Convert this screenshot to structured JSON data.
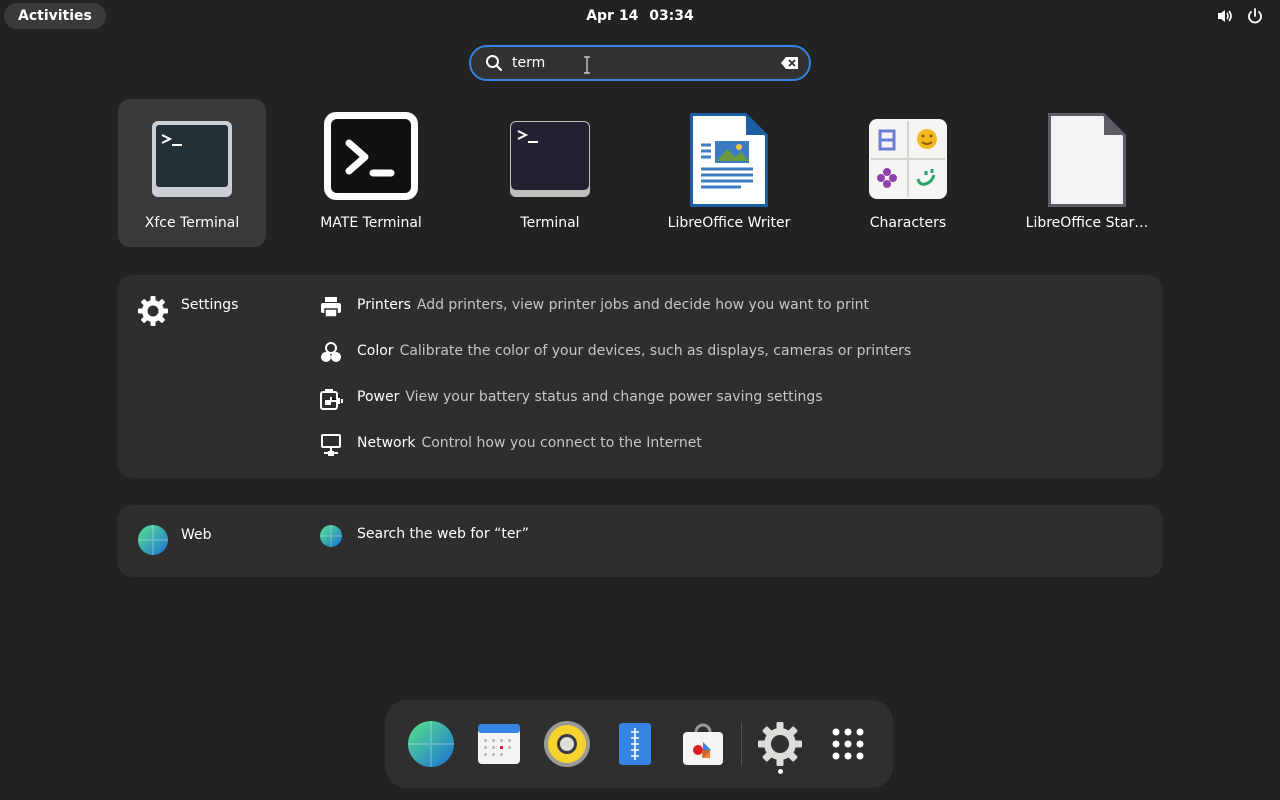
{
  "topbar": {
    "activities_label": "Activities",
    "date": "Apr 14",
    "time": "03:34",
    "icons": [
      "volume-icon",
      "power-icon"
    ]
  },
  "search": {
    "value": "term",
    "icons": [
      "search-icon",
      "clear-icon"
    ]
  },
  "apps": [
    {
      "label": "Xfce Terminal",
      "icon": "xfce-terminal-icon",
      "selected": true
    },
    {
      "label": "MATE Terminal",
      "icon": "mate-terminal-icon",
      "selected": false
    },
    {
      "label": "Terminal",
      "icon": "terminal-icon",
      "selected": false
    },
    {
      "label": "LibreOffice Writer",
      "icon": "libreoffice-writer-icon",
      "selected": false
    },
    {
      "label": "Characters",
      "icon": "characters-icon",
      "selected": false
    },
    {
      "label": "LibreOffice Star…",
      "icon": "libreoffice-startcenter-icon",
      "selected": false
    }
  ],
  "settings_panel": {
    "provider": "Settings",
    "results": [
      {
        "title": "Printers",
        "description": "Add printers, view printer jobs and decide how you want to print",
        "icon": "printer-icon"
      },
      {
        "title": "Color",
        "description": "Calibrate the color of your devices, such as displays, cameras or printers",
        "icon": "color-icon"
      },
      {
        "title": "Power",
        "description": "View your battery status and change power saving settings",
        "icon": "power-plug-icon"
      },
      {
        "title": "Network",
        "description": "Control how you connect to the Internet",
        "icon": "network-icon"
      }
    ]
  },
  "web_panel": {
    "provider": "Web",
    "results": [
      {
        "title": "Search the web for “ter”",
        "icon": "globe-icon"
      }
    ]
  },
  "dock": {
    "items": [
      "web-browser-icon",
      "calendar-icon",
      "rhythmbox-icon",
      "text-editor-icon",
      "software-center-icon",
      "settings-icon",
      "show-apps-icon"
    ]
  },
  "colors": {
    "background": "#222222",
    "panel": "#2e2e2e",
    "accent": "#3584e4"
  }
}
